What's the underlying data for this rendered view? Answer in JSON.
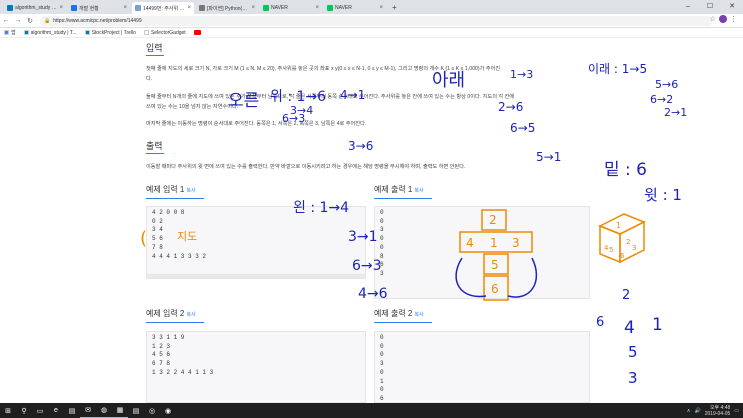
{
  "browser": {
    "tabs": [
      {
        "label": "algorithm_study | Trello",
        "color": "#0079bf",
        "active": false
      },
      {
        "label": "개발 현황",
        "color": "#1a73e8",
        "active": false
      },
      {
        "label": "14499번: 주사위 굴리기",
        "color": "#7aa1d2",
        "active": true
      },
      {
        "label": "[파이썬] Python(파이썬): 표준 출력",
        "color": "#777777",
        "active": false
      },
      {
        "label": "NAVER",
        "color": "#03c75a",
        "active": false
      },
      {
        "label": "NAVER",
        "color": "#03c75a",
        "active": false
      }
    ],
    "url": "https://www.acmicpc.net/problem/14499",
    "bookmarks": [
      {
        "label": "앱",
        "color": "#4285f4"
      },
      {
        "label": "algorithm_study | T...",
        "color": "#0079bf"
      },
      {
        "label": "StockProject | Trello",
        "color": "#0079bf"
      },
      {
        "label": "SelectorGadget",
        "color": "#ffffff"
      }
    ]
  },
  "problem": {
    "input_heading": "입력",
    "input_lines": [
      "첫째 줄에 지도의 세로 크기 N, 가로 크기 M (1 ≤ N, M ≤ 20), 주사위를 놓은 곳의 좌표 x y(0 ≤ x ≤ N-1, 0 ≤ y ≤ M-1), 그리고 명령의 개수 K (1 ≤ K ≤ 1,000)가 주어진",
      "다.",
      "둘째 줄부터 N개의 줄에 지도에 쓰여 있는 수가 북쪽부터 남쪽으로, 각 줄은 서쪽부터 동쪽 순서대로 주어진다. 주사위를 놓은 칸에 쓰여 있는 수는 항상 0이다. 지도의 각 칸에",
      "쓰여 있는 수는 10을 넘지 않는 자연수이다.",
      "마지막 줄에는 이동하는 명령이 순서대로 주어진다. 동쪽은 1, 서쪽은 2, 북쪽은 3, 남쪽은 4로 주어진다."
    ],
    "output_heading": "출력",
    "output_text": "이동할 때마다 주사위의 윗 면에 쓰여 있는 수를 출력한다. 만약 바깥으로 이동시키려고 하는 경우에는 해당 명령을 무시해야 하며, 출력도 하면 안된다.",
    "copy_label": "복사",
    "samples": [
      {
        "title": "예제 입력 1",
        "lines": [
          "4 2 0 0 8",
          "0 2",
          "3 4",
          "5 6",
          "7 8",
          "4 4 4 1 3 3 3 2"
        ]
      },
      {
        "title": "예제 출력 1",
        "lines": [
          "0",
          "0",
          "3",
          "0",
          "0",
          "8",
          "6",
          "3"
        ]
      },
      {
        "title": "예제 입력 2",
        "lines": [
          "3 3 1 1 9",
          "1 2 3",
          "4 5 6",
          "6 7 8",
          "1 3 2 2 4 4 1 1 3"
        ]
      },
      {
        "title": "예제 출력 2",
        "lines": [
          "0",
          "0",
          "0",
          "3",
          "0",
          "1",
          "0",
          "6"
        ]
      }
    ]
  },
  "handwriting": {
    "blue": [
      "이래 : 1→5",
      "5→6",
      "6→2",
      "2→1",
      "오른",
      "위 : 1→6",
      "4→1",
      "3→4",
      "6→3",
      "2→6",
      "6→5",
      "5→1",
      "3→6",
      "아래",
      "1→3",
      "왼 : 1→4",
      "3→1",
      "6→3",
      "4→6",
      "밑 : 6",
      "윗 : 1"
    ],
    "orange_map": "지도",
    "dice_net": [
      "2",
      "4",
      "1",
      "3",
      "5",
      "6"
    ],
    "dice_faces": [
      "1",
      "4",
      "5",
      "6",
      "2",
      "3"
    ],
    "orange_list": [
      "2",
      "6",
      "4",
      "1",
      "5",
      "3"
    ]
  },
  "taskbar": {
    "time": "오후 4:48",
    "date": "2019-04-05",
    "apps": [
      "⊞",
      "⚲",
      "▭",
      "e",
      "▤",
      "✉",
      "◍",
      "▦",
      "▤",
      "◎",
      "◉"
    ]
  }
}
